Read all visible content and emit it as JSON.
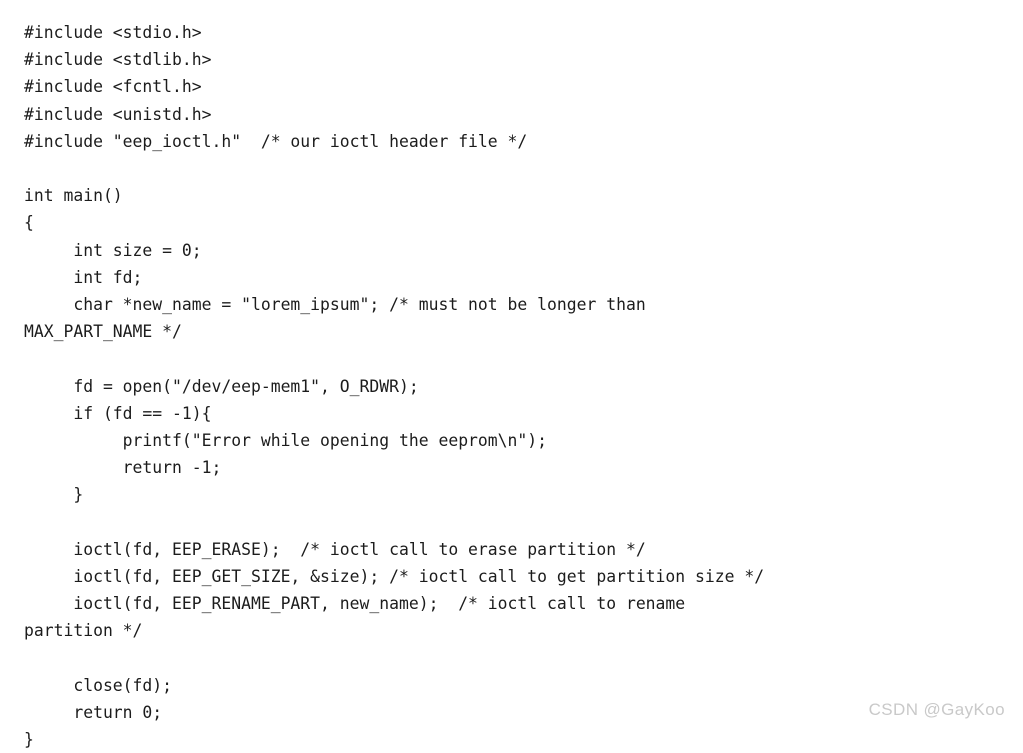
{
  "document": {
    "type": "code-listing",
    "language": "c",
    "background_color": "#ffffff",
    "text_color": "#1c1c1c",
    "lines": [
      {
        "id": "line-1",
        "text": "#include <stdio.h>"
      },
      {
        "id": "line-2",
        "text": "#include <stdlib.h>"
      },
      {
        "id": "line-3",
        "text": "#include <fcntl.h>"
      },
      {
        "id": "line-4",
        "text": "#include <unistd.h>"
      },
      {
        "id": "line-5",
        "text": "#include \"eep_ioctl.h\"  /* our ioctl header file */"
      },
      {
        "id": "line-6",
        "text": ""
      },
      {
        "id": "line-7",
        "text": "int main()"
      },
      {
        "id": "line-8",
        "text": "{"
      },
      {
        "id": "line-9",
        "text": "     int size = 0;"
      },
      {
        "id": "line-10",
        "text": "     int fd;"
      },
      {
        "id": "line-11",
        "text": "     char *new_name = \"lorem_ipsum\"; /* must not be longer than"
      },
      {
        "id": "line-12",
        "text": "MAX_PART_NAME */"
      },
      {
        "id": "line-13",
        "text": ""
      },
      {
        "id": "line-14",
        "text": "     fd = open(\"/dev/eep-mem1\", O_RDWR);"
      },
      {
        "id": "line-15",
        "text": "     if (fd == -1){"
      },
      {
        "id": "line-16",
        "text": "          printf(\"Error while opening the eeprom\\n\");"
      },
      {
        "id": "line-17",
        "text": "          return -1;"
      },
      {
        "id": "line-18",
        "text": "     }"
      },
      {
        "id": "line-19",
        "text": ""
      },
      {
        "id": "line-20",
        "text": "     ioctl(fd, EEP_ERASE);  /* ioctl call to erase partition */"
      },
      {
        "id": "line-21",
        "text": "     ioctl(fd, EEP_GET_SIZE, &size); /* ioctl call to get partition size */"
      },
      {
        "id": "line-22",
        "text": "     ioctl(fd, EEP_RENAME_PART, new_name);  /* ioctl call to rename"
      },
      {
        "id": "line-23",
        "text": "partition */"
      },
      {
        "id": "line-24",
        "text": ""
      },
      {
        "id": "line-25",
        "text": "     close(fd);"
      },
      {
        "id": "line-26",
        "text": "     return 0;"
      },
      {
        "id": "line-27",
        "text": "}"
      }
    ],
    "wrapped_line_ids": [
      "line-12",
      "line-23"
    ]
  },
  "watermark": {
    "text": "CSDN @GayKoo",
    "color": "#c9c9c9"
  }
}
